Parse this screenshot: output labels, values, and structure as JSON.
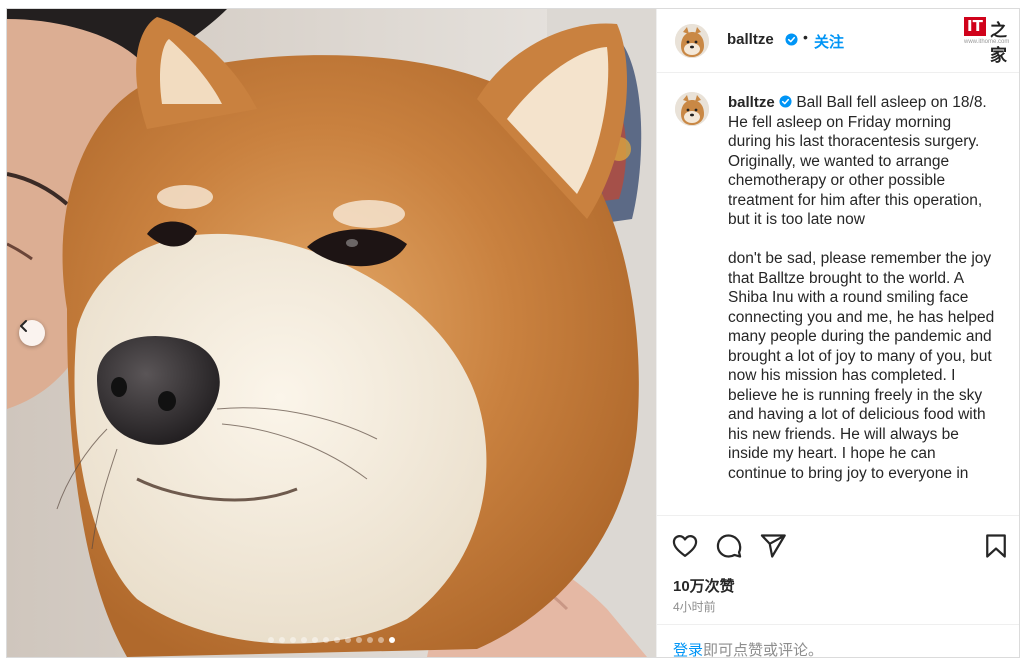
{
  "post": {
    "username": "balltze",
    "follow_label": "关注",
    "separator": "•",
    "caption": {
      "username": "balltze",
      "line1": "Ball Ball fell asleep on 18/8.",
      "para1": "He fell asleep on Friday morning during his last thoracentesis surgery. Originally, we wanted to arrange chemotherapy or other possible treatment for him after this operation, but it is too late now",
      "para2": "don't be sad, please remember the joy that Balltze brought to the world. A Shiba Inu with a round smiling face connecting you and me, he has helped many people during the pandemic and brought a lot of joy to many of you, but now his mission has completed. I believe he is running freely in the sky and having a lot of delicious food with his new friends. He will always be inside my heart. I hope he can continue to bring joy to everyone in"
    },
    "likes": "10万次赞",
    "time_ago": "4小时前",
    "login_link": "登录",
    "login_text": "即可点赞或评论。"
  },
  "watermark": {
    "it": "IT",
    "zh": "之家",
    "sub": "www.ithome.com"
  },
  "carousel": {
    "dot_count": 12,
    "active_index": 11
  },
  "icons": {
    "like": "heart-icon",
    "comment": "comment-icon",
    "share": "paper-plane-icon",
    "save": "bookmark-icon",
    "verified": "verified-badge-icon",
    "prev": "chevron-left-icon"
  },
  "colors": {
    "accent": "#0095f6",
    "text": "#262626",
    "muted": "#8e8e8e",
    "border": "#dbdbdb"
  }
}
